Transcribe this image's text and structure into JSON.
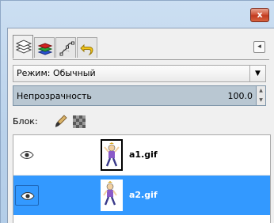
{
  "window": {
    "close_glyph": "x"
  },
  "tabs": [
    {
      "name": "layers-tab",
      "icon": "layers-icon",
      "active": true
    },
    {
      "name": "channels-tab",
      "icon": "channels-icon",
      "active": false
    },
    {
      "name": "paths-tab",
      "icon": "paths-icon",
      "active": false
    },
    {
      "name": "undo-history-tab",
      "icon": "undo-icon",
      "active": false
    }
  ],
  "tab_menu_glyph": "◂",
  "mode": {
    "label": "Режим: Обычный",
    "dropdown_glyph": "▼"
  },
  "opacity": {
    "label": "Непрозрачность",
    "value": "100.0",
    "spin_up": "▲",
    "spin_down": "▼"
  },
  "lock": {
    "label": "Блок:"
  },
  "layers": [
    {
      "name": "a1.gif",
      "visible": true,
      "selected": false
    },
    {
      "name": "a2.gif",
      "visible": true,
      "selected": true
    }
  ],
  "colors": {
    "selection": "#3399ff",
    "opacity_bar": "#b9c7d2",
    "close_button": "#c23b20"
  }
}
